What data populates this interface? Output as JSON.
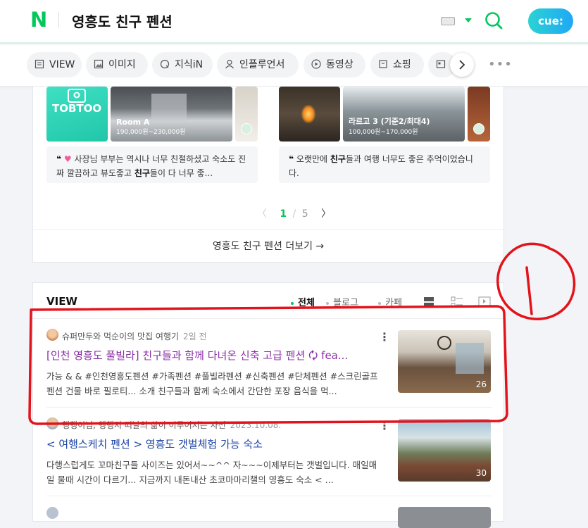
{
  "header": {
    "logo": "N",
    "query": "영흥도 친구 펜션",
    "cue_label": "cue:"
  },
  "tabs": [
    {
      "label": "VIEW",
      "icon": "document-icon"
    },
    {
      "label": "이미지",
      "icon": "image-icon"
    },
    {
      "label": "지식iN",
      "icon": "q-icon"
    },
    {
      "label": "인플루언서",
      "icon": "person-icon"
    },
    {
      "label": "동영상",
      "icon": "play-icon"
    },
    {
      "label": "쇼핑",
      "icon": "bag-icon"
    },
    {
      "label": "",
      "icon": "news-icon"
    }
  ],
  "carousel": {
    "left": {
      "logo_text": "TOBTOO",
      "room_name": "Room A",
      "room_price": "190,000원~230,000원",
      "review_pre": " 사장님 부부는 역시나 너무 친절하셨고 숙소도 진짜 깔끔하고 뷰도좋고 ",
      "review_bold": "친구",
      "review_post": "들이 다 너무 좋...",
      "quote": "❝"
    },
    "right": {
      "room_name": "라르고 3 (기준2/최대4)",
      "room_price": "100,000원~170,000원",
      "review_pre": "오랫만에 ",
      "review_bold": "친구",
      "review_post": "들과 여행 너무도 좋은 추억이었습니다.",
      "quote": "❝"
    },
    "pager_current": "1",
    "pager_sep": "/",
    "pager_total": "5"
  },
  "more_link": "영흥도 친구 펜션 더보기 →",
  "view_section": {
    "title": "VIEW",
    "filters": [
      "전체",
      "블로그",
      "카페"
    ],
    "posts": [
      {
        "author": "슈퍼만두와 먹순이의 맛집 여행기",
        "date": "2일 전",
        "title": "[인천 영흥도 풀빌라] 친구들과 함께 다녀온 신축 고급 펜션 🗘 fea...",
        "desc": "가능 & & #인천영흥도펜션 #가족펜션 #풀빌라펜션 #신축펜션 #단체펜션 #스크린골프펜션 건물 바로 필로티... 소개 친구들과 함께 숙소에서 간단한 포장 음식을 먹...",
        "count": "26"
      },
      {
        "author": "행행이님, 행행지 떠날의 삶이 이루어지는 자전",
        "date": "2023.10.08.",
        "title": "< 여행스케치 펜션 > 영흥도 갯벌체험 가능 숙소",
        "desc": "다행스럽게도 꼬마친구들 사이즈는 있어서~~^^ 자~~~이제부터는 갯벌입니다. 매일매일 물때 시간이 다르기... 지금까지 내돈내산 초코마마리챌의 영흥도 숙소 < ...",
        "count": "30"
      }
    ]
  },
  "annotation": {
    "label": "1",
    "color": "#e3131b"
  }
}
